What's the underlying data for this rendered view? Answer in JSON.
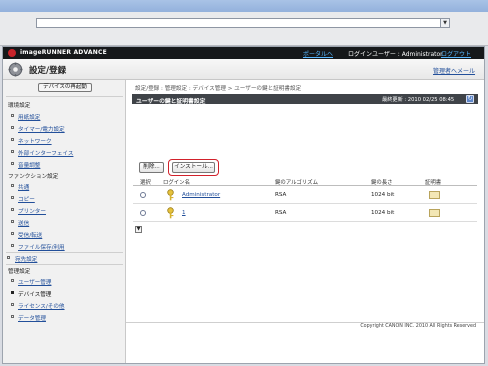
{
  "colors": {
    "brand_red": "#c8242b",
    "link_blue": "#224f9a",
    "portal_blue": "#59b8ff",
    "header_black": "#16181a",
    "highlight_red": "#d2212b"
  },
  "browser": {
    "address": ""
  },
  "header": {
    "brand": "imageRUNNER ADVANCE",
    "portal_link": "ポータルへ",
    "login_user_label": "ログインユーザー : Administrator",
    "logout_link": "ログアウト"
  },
  "titlebar": {
    "title": "設定/登録",
    "admin_mail_link": "管理者へメール",
    "icon": "gear-icon"
  },
  "sidebar": {
    "restart_button": "デバイスの再起動",
    "groups": [
      {
        "header": "環境設定",
        "items": [
          {
            "label": "用紙設定"
          },
          {
            "label": "タイマー/電力設定"
          },
          {
            "label": "ネットワーク"
          },
          {
            "label": "外部インターフェイス"
          },
          {
            "label": "音量調整"
          }
        ]
      },
      {
        "header": "ファンクション設定",
        "items": [
          {
            "label": "共通"
          },
          {
            "label": "コピー"
          },
          {
            "label": "プリンター"
          },
          {
            "label": "送信"
          },
          {
            "label": "受信/転送"
          },
          {
            "label": "ファイル保存/利用"
          }
        ]
      },
      {
        "header": "宛先設定",
        "items": []
      },
      {
        "header": "管理設定",
        "items": [
          {
            "label": "ユーザー管理"
          },
          {
            "label": "デバイス管理",
            "active": true
          },
          {
            "label": "ライセンス/その他"
          },
          {
            "label": "データ管理"
          }
        ]
      }
    ]
  },
  "main": {
    "breadcrumb": "設定/登録 : 管理設定 : デバイス管理 > ユーザーの鍵と証明書設定",
    "panel_title": "ユーザーの鍵と証明書設定",
    "last_update": "最終更新 : 2010 02/25 08:45",
    "delete_button": "削除...",
    "install_button": "インストール...",
    "columns": [
      "選択",
      "ログイン名",
      "鍵のアルゴリズム",
      "鍵の長さ",
      "証明書"
    ],
    "rows": [
      {
        "login_name": "Administrator",
        "algorithm": "RSA",
        "key_length": "1024 bit"
      },
      {
        "login_name": "1",
        "algorithm": "RSA",
        "key_length": "1024 bit"
      }
    ]
  },
  "footer": {
    "copyright": "Copyright CANON INC. 2010 All Rights Reserved"
  }
}
